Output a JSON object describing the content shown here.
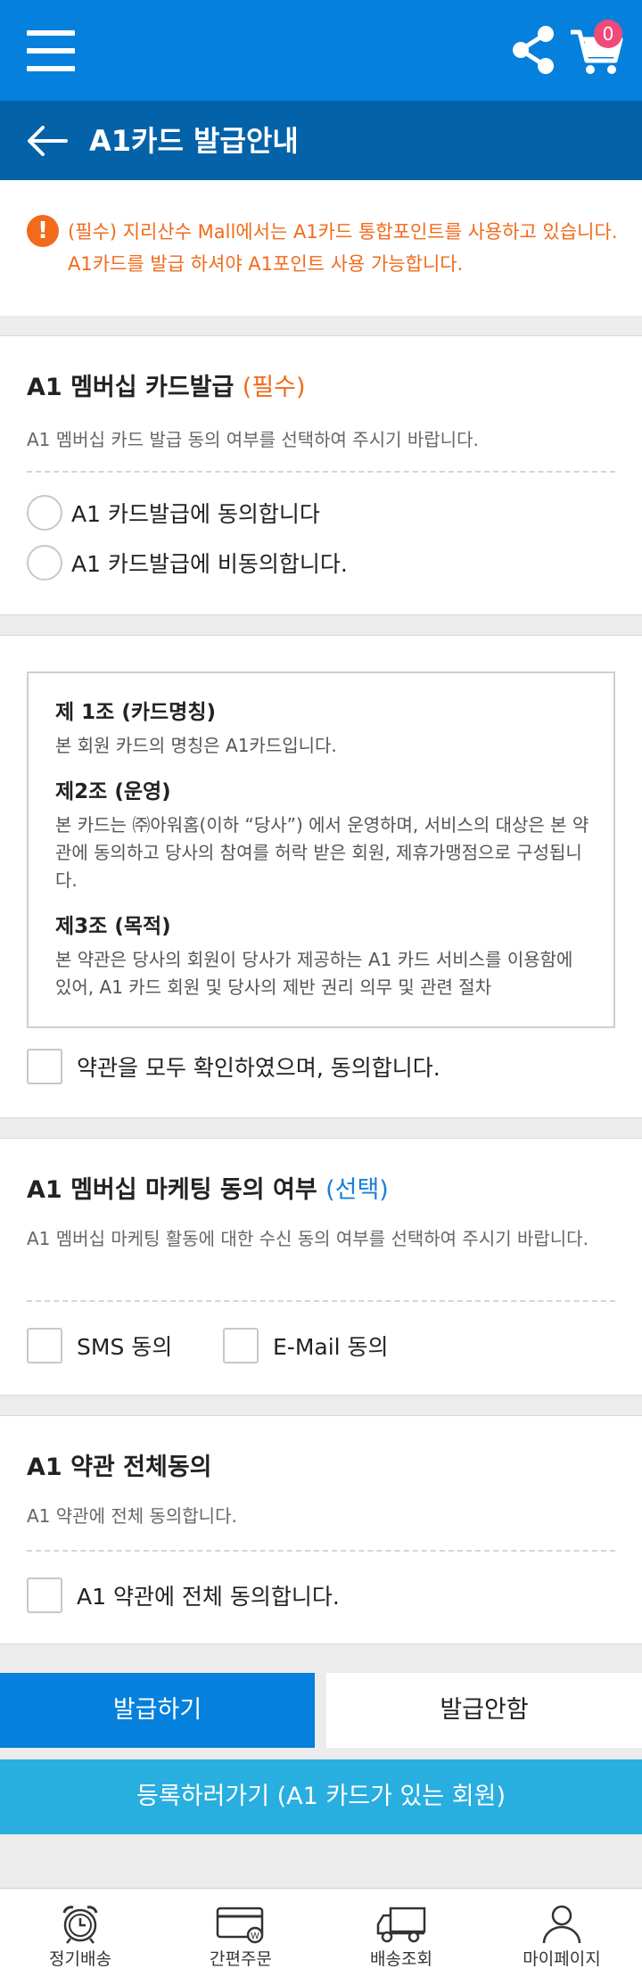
{
  "header": {
    "cart_count": "0",
    "title": "A1카드 발급안내"
  },
  "notice": {
    "text": "(필수) 지리산수 Mall에서는 A1카드 통합포인트를 사용하고 있습니다. A1카드를 발급 하셔야 A1포인트 사용 가능합니다."
  },
  "membership": {
    "title": "A1 멤버십 카드발급",
    "required_tag": "(필수)",
    "desc": "A1 멤버십 카드 발급 동의 여부를 선택하여 주시기 바랍니다.",
    "options": [
      "A1 카드발급에 동의합니다",
      "A1 카드발급에 비동의합니다."
    ]
  },
  "terms": {
    "articles": [
      {
        "title": "제 1조 (카드명칭)",
        "body": "본 회원 카드의 명칭은 A1카드입니다."
      },
      {
        "title": "제2조 (운영)",
        "body": "본 카드는 ㈜아워홈(이하 “당사”) 에서 운영하며, 서비스의 대상은 본 약관에 동의하고 당사의 참여를 허락 받은 회원, 제휴가맹점으로 구성됩니다."
      },
      {
        "title": "제3조 (목적)",
        "body": "본 약관은 당사의 회원이 당사가 제공하는 A1 카드 서비스를 이용함에 있어, A1 카드 회원 및 당사의 제반 권리 의무 및 관련 절차"
      }
    ],
    "agree_label": "약관을 모두 확인하였으며, 동의합니다."
  },
  "marketing": {
    "title": "A1 멤버십 마케팅 동의 여부",
    "optional_tag": "(선택)",
    "desc": "A1 멤버십 마케팅 활동에 대한 수신 동의 여부를 선택하여 주시기 바랍니다.",
    "sms_label": "SMS 동의",
    "email_label": "E-Mail 동의"
  },
  "all_agree": {
    "title": "A1 약관 전체동의",
    "desc": "A1 약관에 전체 동의합니다.",
    "check_label": "A1 약관에 전체 동의합니다."
  },
  "buttons": {
    "issue": "발급하기",
    "no_issue": "발급안함",
    "register": "등록하러가기 (A1 카드가 있는 회원)"
  },
  "bottom_nav": {
    "items": [
      "정기배송",
      "간편주문",
      "배송조회",
      "마이페이지"
    ]
  },
  "colors": {
    "primary": "#0580dc",
    "title_bar": "#0462a8",
    "accent_orange": "#f26a1b",
    "register": "#29aee0",
    "badge": "#ef4a78"
  }
}
